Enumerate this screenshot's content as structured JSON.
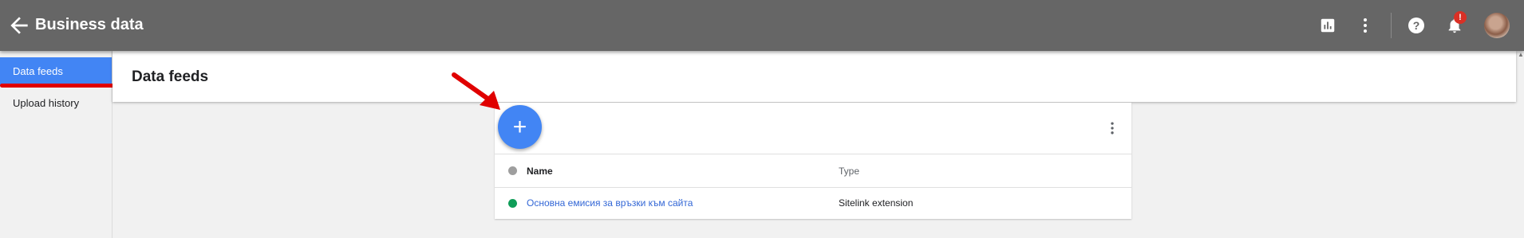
{
  "header": {
    "title": "Business data",
    "notification_count": "!",
    "icons": [
      "back-arrow-icon",
      "reports-icon",
      "more-vert-icon",
      "help-icon",
      "notifications-icon"
    ]
  },
  "sidebar": {
    "items": [
      {
        "label": "Data feeds",
        "active": true
      },
      {
        "label": "Upload history",
        "active": false
      }
    ]
  },
  "page": {
    "title": "Data feeds"
  },
  "table": {
    "add_button_label": "+",
    "columns": {
      "name": "Name",
      "type": "Type"
    },
    "rows": [
      {
        "name": "Основна емисия за връзки към сайта",
        "type": "Sitelink extension",
        "status_color": "#0f9d58"
      }
    ]
  },
  "colors": {
    "topbar": "#666666",
    "accent": "#4285f4",
    "link": "#3367d6",
    "annotation": "#e00000"
  }
}
